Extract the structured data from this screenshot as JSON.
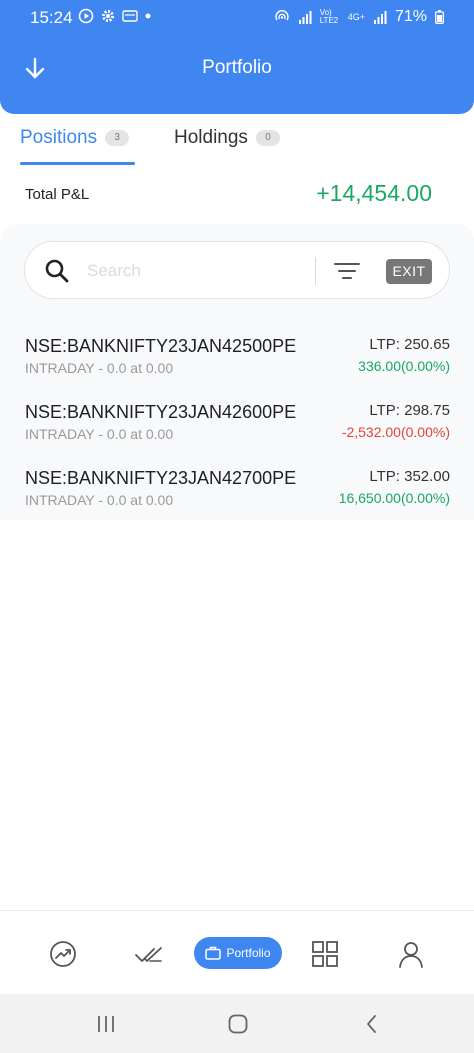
{
  "status_bar": {
    "time": "15:24",
    "left_icons": [
      "play-circle-icon",
      "gear-icon",
      "notification-icon",
      "dot-icon"
    ],
    "right_icons": [
      "hotspot-icon",
      "signal-icon",
      "volte-icon",
      "signal-icon"
    ],
    "network_label": "Vo) LTE2",
    "network_label2": "4G+",
    "battery": "71%"
  },
  "header": {
    "title": "Portfolio"
  },
  "tabs": [
    {
      "label": "Positions",
      "count": "3",
      "active": true
    },
    {
      "label": "Holdings",
      "count": "0",
      "active": false
    }
  ],
  "pnl": {
    "label": "Total P&L",
    "value": "+14,454.00",
    "color": "#1aa862"
  },
  "search": {
    "placeholder": "Search",
    "exit_label": "EXIT"
  },
  "positions": [
    {
      "symbol": "NSE:BANKNIFTY23JAN42500PE",
      "sub": "INTRADAY -  0.0 at 0.00",
      "ltp": "LTP: 250.65",
      "change": "336.00(0.00%)",
      "direction": "pos"
    },
    {
      "symbol": "NSE:BANKNIFTY23JAN42600PE",
      "sub": "INTRADAY -  0.0 at 0.00",
      "ltp": "LTP: 298.75",
      "change": "-2,532.00(0.00%)",
      "direction": "neg"
    },
    {
      "symbol": "NSE:BANKNIFTY23JAN42700PE",
      "sub": "INTRADAY -  0.0 at 0.00",
      "ltp": "LTP: 352.00",
      "change": "16,650.00(0.00%)",
      "direction": "pos"
    }
  ],
  "bottom_nav": {
    "items": [
      "trending-icon",
      "double-check-icon",
      "portfolio-icon",
      "grid-icon",
      "user-icon"
    ],
    "active_label": "Portfolio"
  },
  "colors": {
    "accent": "#3f86f0",
    "positive": "#1aa862",
    "negative": "#e0453a"
  }
}
